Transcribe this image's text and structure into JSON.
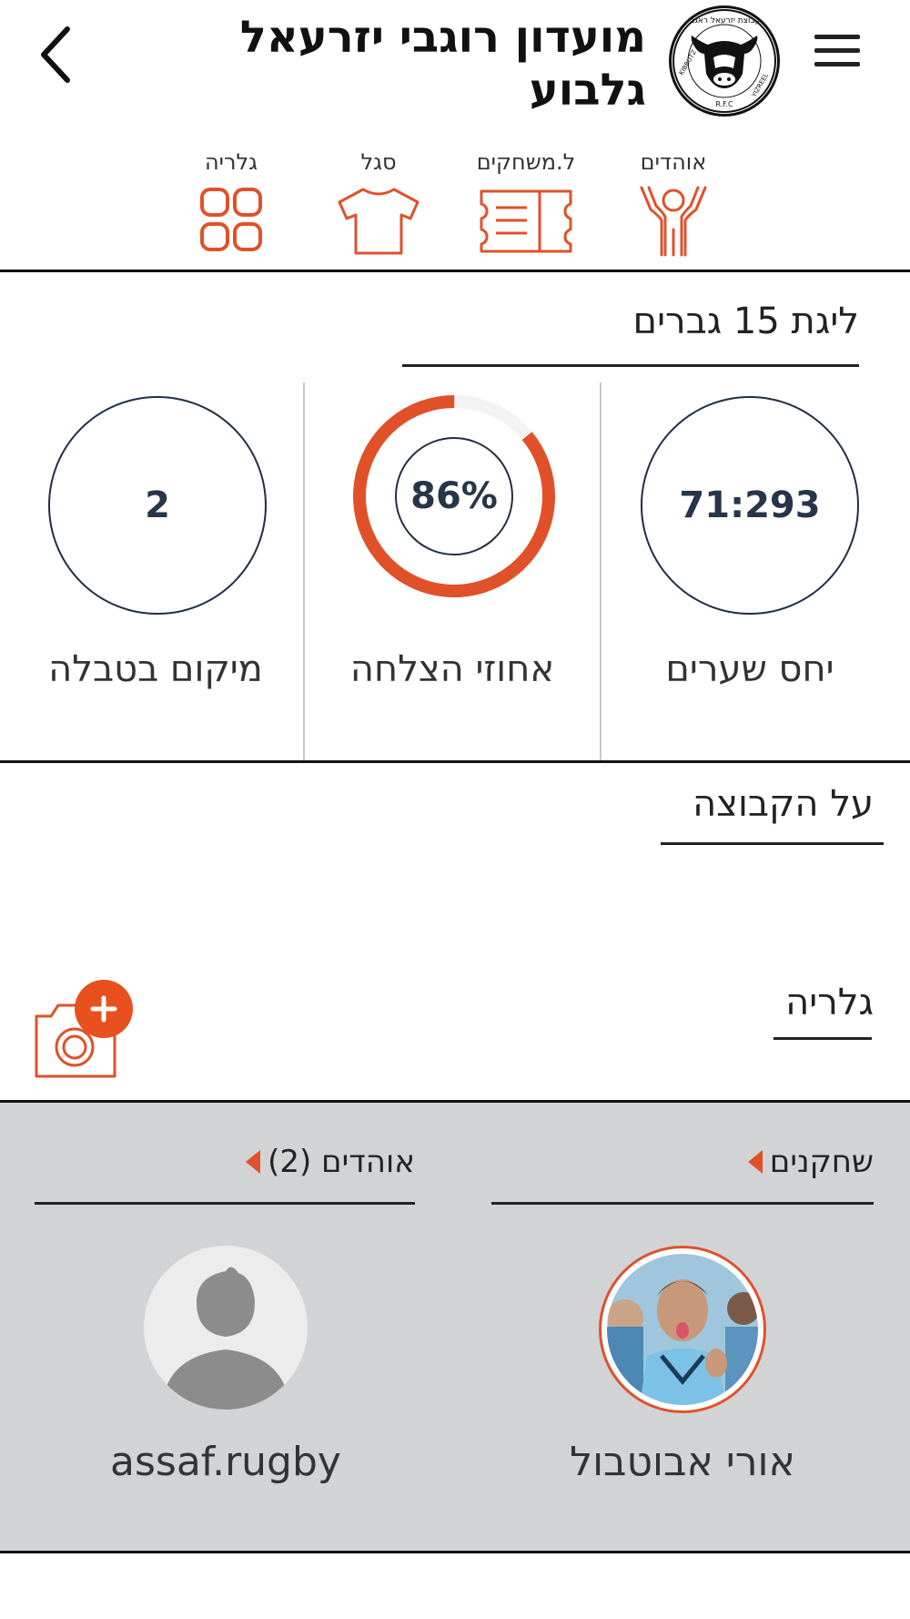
{
  "header": {
    "title_line1": "מועדון רוגבי יזרעאל",
    "title_line2": "גלבוע",
    "back_icon": "chevron-left-icon",
    "menu_icon": "hamburger-menu-icon",
    "logo_icon": "cow-logo-icon",
    "logo_text_top": "קבוצת יזרעאל ראגבי",
    "logo_text_left": "KIBBUTZ",
    "logo_text_right": "YIZREEL",
    "logo_text_bottom": "R.F.C"
  },
  "quick_nav": [
    {
      "label": "אוהדים",
      "icon": "fan-cheering-icon"
    },
    {
      "label": "ל.משחקים",
      "icon": "ticket-icon"
    },
    {
      "label": "סגל",
      "icon": "tshirt-icon"
    },
    {
      "label": "גלריה",
      "icon": "gallery-grid-icon"
    }
  ],
  "league": {
    "title": "ליגת 15 גברים",
    "stats": {
      "goals_ratio": {
        "value": "71:293",
        "label": "יחס שערים"
      },
      "success_rate": {
        "value": "86%",
        "label": "אחוזי הצלחה",
        "fraction": 0.86
      },
      "table_position": {
        "value": "2",
        "label": "מיקום בטבלה"
      }
    }
  },
  "about": {
    "title": "על הקבוצה"
  },
  "gallery": {
    "title": "גלריה",
    "add_icon": "camera-add-icon"
  },
  "players": {
    "title": "שחקנים",
    "items": [
      {
        "name": "אורי אבוטבול",
        "avatar": "player-photo"
      }
    ]
  },
  "fans": {
    "title": "אוהדים (2)",
    "items": [
      {
        "name": "assaf.rugby",
        "avatar": "default-avatar-icon"
      }
    ]
  },
  "colors": {
    "accent": "#e0512a",
    "navy": "#1f2f44",
    "panel": "#d2d3d5"
  }
}
